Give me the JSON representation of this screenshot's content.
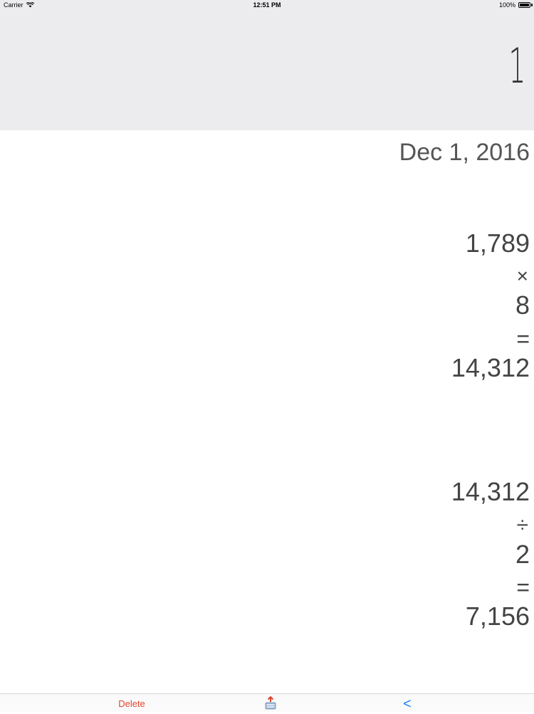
{
  "status_bar": {
    "carrier": "Carrier",
    "time": "12:51 PM",
    "battery": "100%"
  },
  "display": {
    "value": "1"
  },
  "tape": {
    "date": "Dec 1, 2016",
    "calc1": {
      "operand1": "1,789",
      "operator": "×",
      "operand2": "8",
      "equals": "=",
      "result": "14,312"
    },
    "calc2": {
      "operand1": "14,312",
      "operator": "÷",
      "operand2": "2",
      "equals": "=",
      "result": "7,156"
    }
  },
  "toolbar": {
    "delete_label": "Delete",
    "back_label": "<",
    "share_icon": "share-tray-icon"
  },
  "colors": {
    "display_bg": "#ececef",
    "delete": "#e2442f",
    "back": "#1e7df7"
  }
}
